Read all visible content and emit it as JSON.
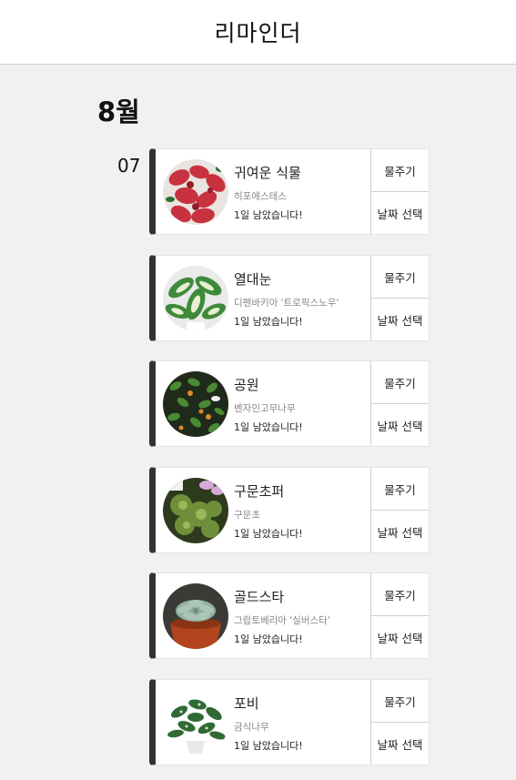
{
  "header": {
    "title": "리마인더"
  },
  "month": "8월",
  "day": "07",
  "plants": [
    {
      "name": "귀여운 식물",
      "species": "히포에스테스",
      "remaining": "1일 남았습니다!",
      "water_label": "물주기",
      "date_label": "날짜 선택",
      "photo_icon": "red-leaf-plant-photo"
    },
    {
      "name": "열대눈",
      "species": "디펜바키아 '트로픽스노우'",
      "remaining": "1일 남았습니다!",
      "water_label": "물주기",
      "date_label": "날짜 선택",
      "photo_icon": "dieffenbachia-photo"
    },
    {
      "name": "공원",
      "species": "벤자민고무나무",
      "remaining": "1일 남았습니다!",
      "water_label": "물주기",
      "date_label": "날짜 선택",
      "photo_icon": "ficus-photo"
    },
    {
      "name": "구문초퍼",
      "species": "구문초",
      "remaining": "1일 남았습니다!",
      "water_label": "물주기",
      "date_label": "날짜 선택",
      "photo_icon": "geranium-photo"
    },
    {
      "name": "골드스타",
      "species": "그랍토베리아 '실버스타'",
      "remaining": "1일 남았습니다!",
      "water_label": "물주기",
      "date_label": "날짜 선택",
      "photo_icon": "succulent-photo"
    },
    {
      "name": "포비",
      "species": "금식나무",
      "remaining": "1일 남았습니다!",
      "water_label": "물주기",
      "date_label": "날짜 선택",
      "photo_icon": "aucuba-photo"
    }
  ]
}
